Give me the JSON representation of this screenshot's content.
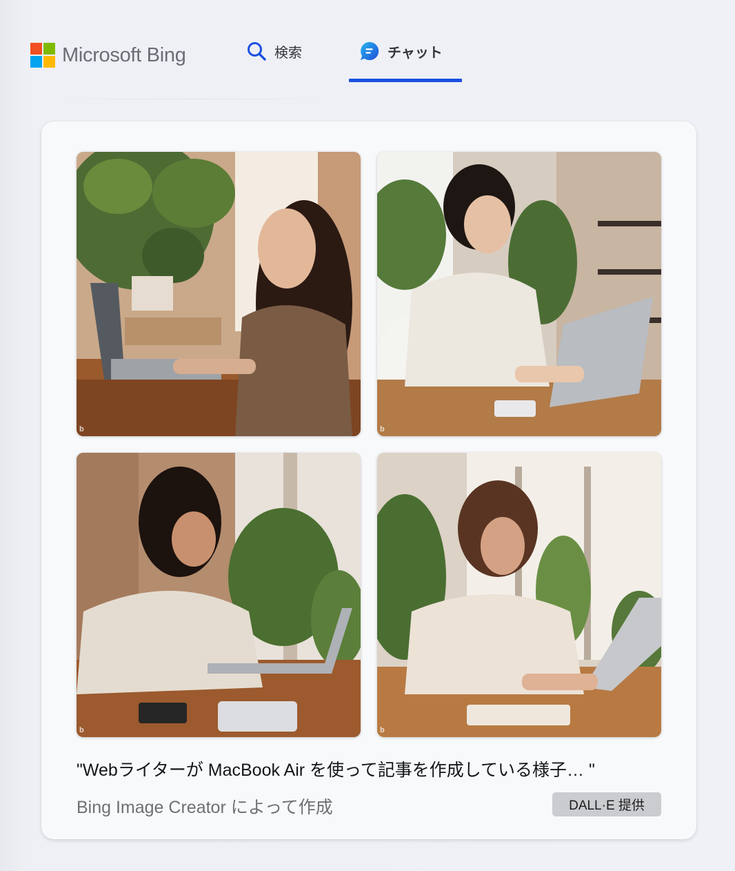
{
  "header": {
    "brand": "Microsoft Bing",
    "tabs": [
      {
        "label": "検索",
        "icon": "search-icon",
        "active": false
      },
      {
        "label": "チャット",
        "icon": "chat-icon",
        "active": true
      }
    ],
    "colors": {
      "accent": "#1a4fe0",
      "logo_red": "#f25022",
      "logo_green": "#7fba00",
      "logo_blue": "#00a4ef",
      "logo_yellow": "#ffb900"
    }
  },
  "card": {
    "images": [
      {
        "label": "woman-laptop-plants-1",
        "watermark": "b"
      },
      {
        "label": "woman-laptop-short-hair-2",
        "watermark": "b"
      },
      {
        "label": "woman-laptop-window-3",
        "watermark": "b"
      },
      {
        "label": "woman-laptop-cafe-4",
        "watermark": "b"
      }
    ],
    "prompt_caption": "\"Webライターが MacBook Air を使って記事を作成している様子… \"",
    "credit": "Bing Image Creator によって作成",
    "badge": "DALL·E 提供"
  }
}
